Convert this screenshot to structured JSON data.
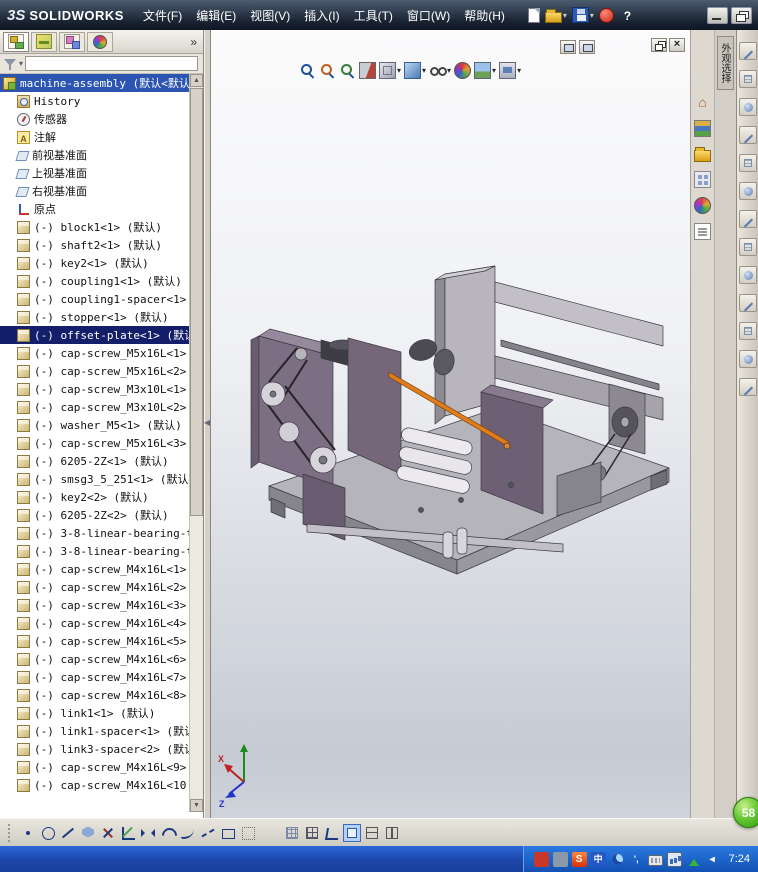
{
  "titlebar": {
    "logo_mark": "3S",
    "logo_text": "SOLIDWORKS",
    "menus": [
      {
        "key": "file",
        "label": "文件(F)"
      },
      {
        "key": "edit",
        "label": "编辑(E)"
      },
      {
        "key": "view",
        "label": "视图(V)"
      },
      {
        "key": "insert",
        "label": "插入(I)"
      },
      {
        "key": "tools",
        "label": "工具(T)"
      },
      {
        "key": "window",
        "label": "窗口(W)"
      },
      {
        "key": "help",
        "label": "帮助(H)"
      }
    ],
    "quick_icons": [
      {
        "name": "new-document-icon"
      },
      {
        "name": "open-icon",
        "dropdown": true
      },
      {
        "name": "save-icon",
        "dropdown": true
      },
      {
        "name": "user-session-icon"
      },
      {
        "name": "help-icon"
      }
    ],
    "window_controls": [
      {
        "name": "minimize-button"
      },
      {
        "name": "restore-button"
      }
    ]
  },
  "feature_panel": {
    "tabs": [
      {
        "name": "featuremanager-tree-tab-icon"
      },
      {
        "name": "propertymanager-tab-icon"
      },
      {
        "name": "configurationmanager-tab-icon"
      },
      {
        "name": "appearances-scenes-tab-icon"
      }
    ],
    "overflow_glyph": "»",
    "tree": [
      {
        "label": "machine-assembly (默认<默认",
        "icon": "assembly",
        "selected": "root"
      },
      {
        "label": "History",
        "icon": "history",
        "child": true
      },
      {
        "label": "传感器",
        "icon": "sensor",
        "child": true
      },
      {
        "label": "注解",
        "icon": "annotation",
        "child": true
      },
      {
        "label": "前视基准面",
        "icon": "plane",
        "child": true
      },
      {
        "label": "上视基准面",
        "icon": "plane",
        "child": true
      },
      {
        "label": "右视基准面",
        "icon": "plane",
        "child": true
      },
      {
        "label": "原点",
        "icon": "origin",
        "child": true
      },
      {
        "label": "(-) block1<1> (默认)",
        "icon": "part",
        "child": true
      },
      {
        "label": "(-) shaft2<1> (默认)",
        "icon": "part",
        "child": true
      },
      {
        "label": "(-) key2<1> (默认)",
        "icon": "part",
        "child": true
      },
      {
        "label": "(-) coupling1<1> (默认)",
        "icon": "part",
        "child": true
      },
      {
        "label": "(-) coupling1-spacer<1>",
        "icon": "part",
        "child": true
      },
      {
        "label": "(-) stopper<1> (默认)",
        "icon": "part",
        "child": true
      },
      {
        "label": "(-) offset-plate<1> (默认",
        "icon": "part",
        "child": true,
        "selected": "comp"
      },
      {
        "label": "(-) cap-screw_M5x16L<1>",
        "icon": "part",
        "child": true
      },
      {
        "label": "(-) cap-screw_M5x16L<2>",
        "icon": "part",
        "child": true
      },
      {
        "label": "(-) cap-screw_M3x10L<1>",
        "icon": "part",
        "child": true
      },
      {
        "label": "(-) cap-screw_M3x10L<2>",
        "icon": "part",
        "child": true
      },
      {
        "label": "(-) washer_M5<1> (默认)",
        "icon": "part",
        "child": true
      },
      {
        "label": "(-) cap-screw_M5x16L<3>",
        "icon": "part",
        "child": true
      },
      {
        "label": "(-) 6205-2Z<1> (默认)",
        "icon": "part",
        "child": true
      },
      {
        "label": "(-) smsg3_5_251<1> (默认",
        "icon": "part",
        "child": true
      },
      {
        "label": "(-) key2<2> (默认)",
        "icon": "part",
        "child": true
      },
      {
        "label": "(-) 6205-2Z<2> (默认)",
        "icon": "part",
        "child": true
      },
      {
        "label": "(-) 3-8-linear-bearing-t",
        "icon": "part",
        "child": true
      },
      {
        "label": "(-) 3-8-linear-bearing-t",
        "icon": "part",
        "child": true
      },
      {
        "label": "(-) cap-screw_M4x16L<1>",
        "icon": "part",
        "child": true
      },
      {
        "label": "(-) cap-screw_M4x16L<2>",
        "icon": "part",
        "child": true
      },
      {
        "label": "(-) cap-screw_M4x16L<3>",
        "icon": "part",
        "child": true
      },
      {
        "label": "(-) cap-screw_M4x16L<4>",
        "icon": "part",
        "child": true
      },
      {
        "label": "(-) cap-screw_M4x16L<5>",
        "icon": "part",
        "child": true
      },
      {
        "label": "(-) cap-screw_M4x16L<6>",
        "icon": "part",
        "child": true
      },
      {
        "label": "(-) cap-screw_M4x16L<7>",
        "icon": "part",
        "child": true
      },
      {
        "label": "(-) cap-screw_M4x16L<8>",
        "icon": "part",
        "child": true
      },
      {
        "label": "(-) link1<1> (默认)",
        "icon": "part",
        "child": true
      },
      {
        "label": "(-) link1-spacer<1> (默认",
        "icon": "part",
        "child": true
      },
      {
        "label": "(-) link3-spacer<2> (默认",
        "icon": "part",
        "child": true
      },
      {
        "label": "(-) cap-screw_M4x16L<9>",
        "icon": "part",
        "child": true
      },
      {
        "label": "(-) cap-screw_M4x16L<10",
        "icon": "part",
        "child": true
      }
    ]
  },
  "viewport": {
    "doc_buttons": [
      {
        "name": "doc-button-1"
      },
      {
        "name": "doc-button-2"
      }
    ],
    "doc_window_controls": [
      {
        "name": "doc-restore-button"
      },
      {
        "name": "doc-close-button"
      }
    ],
    "headsup_icons": [
      {
        "name": "zoom-fit-icon"
      },
      {
        "name": "zoom-area-icon"
      },
      {
        "name": "previous-view-icon"
      },
      {
        "name": "section-view-icon"
      },
      {
        "name": "view-orientation-icon",
        "dropdown": true
      },
      {
        "name": "display-style-icon",
        "dropdown": true
      },
      {
        "name": "hide-show-items-icon",
        "dropdown": true
      },
      {
        "name": "edit-appearance-icon"
      },
      {
        "name": "apply-scene-icon",
        "dropdown": true
      },
      {
        "name": "view-settings-icon",
        "dropdown": true
      }
    ],
    "triad": {
      "x_label": "X",
      "z_label": "Z"
    }
  },
  "task_pane": {
    "vertical_tab_label": "外观选择",
    "icons": [
      {
        "name": "solidworks-resources-home-icon"
      },
      {
        "name": "design-library-icon"
      },
      {
        "name": "file-explorer-icon"
      },
      {
        "name": "view-palette-icon"
      },
      {
        "name": "appearances-scenes-icon"
      },
      {
        "name": "custom-properties-icon"
      }
    ]
  },
  "right_dock": {
    "icons": [
      {
        "name": "dock-tool-icon-1"
      },
      {
        "name": "dock-tool-icon-2"
      },
      {
        "name": "dock-tool-icon-3"
      },
      {
        "name": "dock-tool-icon-4"
      },
      {
        "name": "dock-tool-icon-5"
      },
      {
        "name": "dock-tool-icon-6"
      },
      {
        "name": "dock-tool-icon-7"
      },
      {
        "name": "dock-tool-icon-8"
      },
      {
        "name": "dock-tool-icon-9"
      },
      {
        "name": "dock-tool-icon-10"
      },
      {
        "name": "dock-tool-icon-11"
      },
      {
        "name": "dock-tool-icon-12"
      },
      {
        "name": "dock-tool-icon-13"
      }
    ]
  },
  "sketch_toolbar": {
    "draw_icons": [
      {
        "name": "point-icon"
      },
      {
        "name": "circle-icon"
      },
      {
        "name": "line-icon"
      },
      {
        "name": "polygon-icon"
      },
      {
        "name": "trim-icon"
      },
      {
        "name": "chamfer-icon"
      },
      {
        "name": "mirror-icon"
      },
      {
        "name": "arc-icon"
      },
      {
        "name": "spline-icon"
      },
      {
        "name": "centerline-icon"
      },
      {
        "name": "rectangle-icon"
      },
      {
        "name": "construction-icon"
      }
    ],
    "view_icons": [
      {
        "name": "grid-snap-icon"
      },
      {
        "name": "unit-grid-icon"
      },
      {
        "name": "angle-snap-icon"
      },
      {
        "name": "single-view-icon",
        "active": true
      },
      {
        "name": "two-view-horizontal-icon"
      },
      {
        "name": "two-view-vertical-icon"
      }
    ]
  },
  "taskbar": {
    "tray_icons": [
      {
        "name": "tray-app-icon-1"
      },
      {
        "name": "tray-app-icon-2"
      },
      {
        "name": "sogou-pinyin-icon",
        "glyph": "S"
      },
      {
        "name": "ime-language-icon",
        "glyph": "中"
      },
      {
        "name": "moon-icon"
      },
      {
        "name": "punctuation-icon",
        "glyph": "’,"
      },
      {
        "name": "soft-keyboard-icon"
      },
      {
        "name": "chart-icon"
      },
      {
        "name": "green-arrows-icon"
      },
      {
        "name": "show-hidden-icon"
      }
    ],
    "clock": "7:24"
  },
  "overlay": {
    "badge_value": "58"
  }
}
